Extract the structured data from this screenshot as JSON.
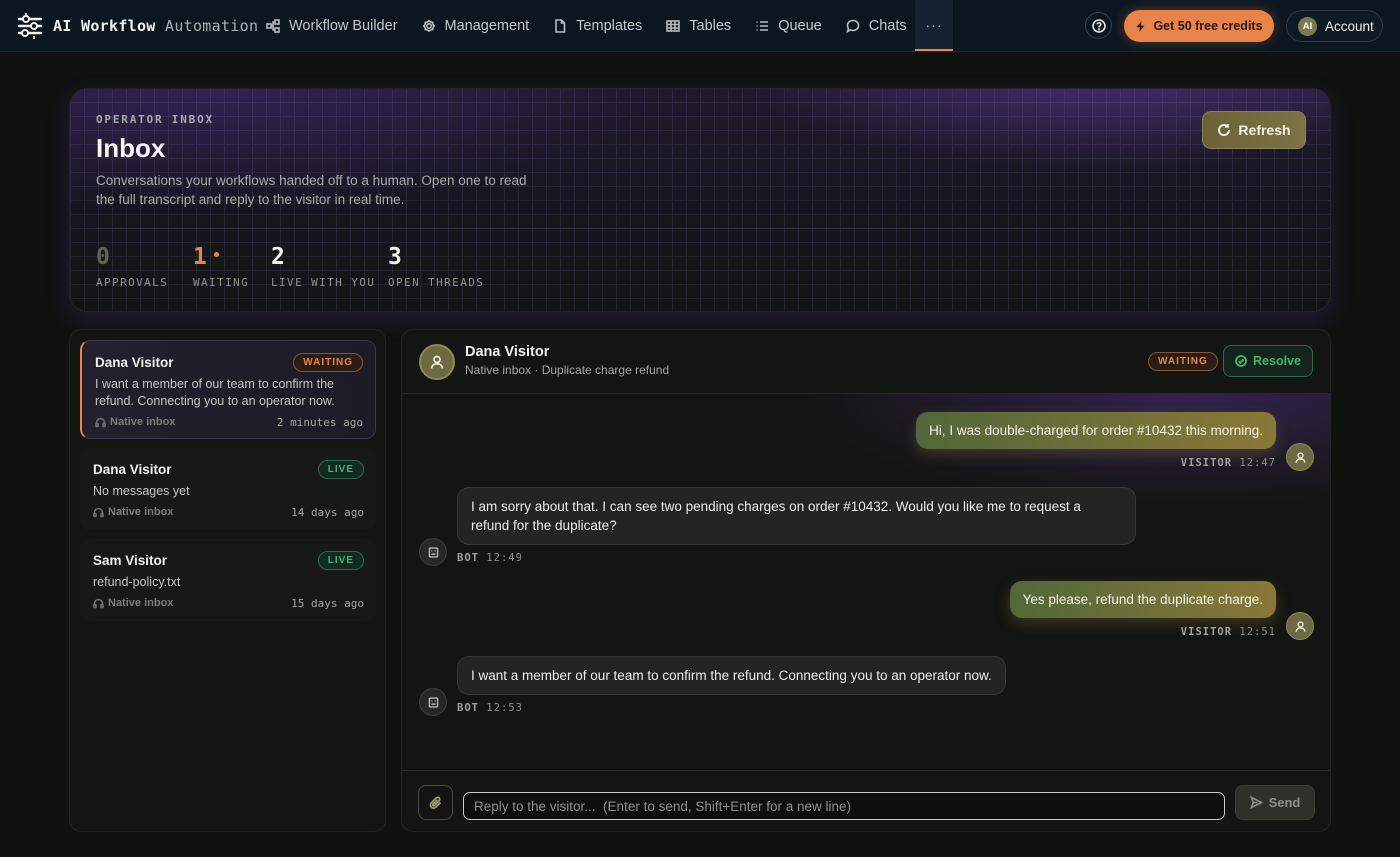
{
  "nav": {
    "brand_primary": "AI Workflow",
    "brand_secondary": "Automation",
    "links": [
      {
        "label": "Workflow Builder",
        "icon": "workflow-icon"
      },
      {
        "label": "Management",
        "icon": "gear-icon"
      },
      {
        "label": "Templates",
        "icon": "file-icon"
      },
      {
        "label": "Tables",
        "icon": "table-icon"
      },
      {
        "label": "Queue",
        "icon": "list-icon"
      },
      {
        "label": "Chats",
        "icon": "chat-icon"
      }
    ],
    "more_label": "···",
    "credits_label": "Get 50 free credits",
    "account_initials": "AI",
    "account_label": "Account"
  },
  "hero": {
    "eyebrow": "OPERATOR INBOX",
    "title": "Inbox",
    "description": "Conversations your workflows handed off to a human. Open one to read the full transcript and reply to the visitor in real time.",
    "refresh_label": "Refresh",
    "stats": [
      {
        "value": "0",
        "label": "APPROVALS",
        "color": "#6b6f57"
      },
      {
        "value": "1",
        "label": "WAITING",
        "color": "#e8844a"
      },
      {
        "value": "2",
        "label": "LIVE WITH YOU",
        "color": "#f2f2ef"
      },
      {
        "value": "3",
        "label": "OPEN THREADS",
        "color": "#f2f2ef"
      }
    ]
  },
  "conversations": [
    {
      "name": "Dana Visitor",
      "badge": "WAITING",
      "preview": "I want a member of our team to confirm the refund. Connecting you to an operator now.",
      "source": "Native inbox",
      "time": "2 minutes ago"
    },
    {
      "name": "Dana Visitor",
      "badge": "LIVE",
      "preview": "No messages yet",
      "source": "Native inbox",
      "time": "14 days ago"
    },
    {
      "name": "Sam Visitor",
      "badge": "LIVE",
      "preview": "refund-policy.txt",
      "source": "Native inbox",
      "time": "15 days ago"
    }
  ],
  "chat": {
    "name": "Dana Visitor",
    "subtitle": "Native inbox · Duplicate charge refund",
    "badge": "WAITING",
    "resolve_label": "Resolve",
    "messages": [
      {
        "sender": "VISITOR",
        "time": "12:47",
        "text": "Hi, I was double-charged for order #10432 this morning."
      },
      {
        "sender": "BOT",
        "time": "12:49",
        "text": "I am sorry about that. I can see two pending charges on order #10432. Would you like me to request a refund for the duplicate?"
      },
      {
        "sender": "VISITOR",
        "time": "12:51",
        "text": "Yes please, refund the duplicate charge."
      },
      {
        "sender": "BOT",
        "time": "12:53",
        "text": "I want a member of our team to confirm the refund. Connecting you to an operator now."
      }
    ],
    "reply_placeholder": "Reply to the visitor...  (Enter to send, Shift+Enter for a new line)",
    "send_label": "Send"
  },
  "colors": {
    "accent_orange": "#e8844a",
    "live_green": "#3fb37a",
    "olive": "#7d7444"
  }
}
